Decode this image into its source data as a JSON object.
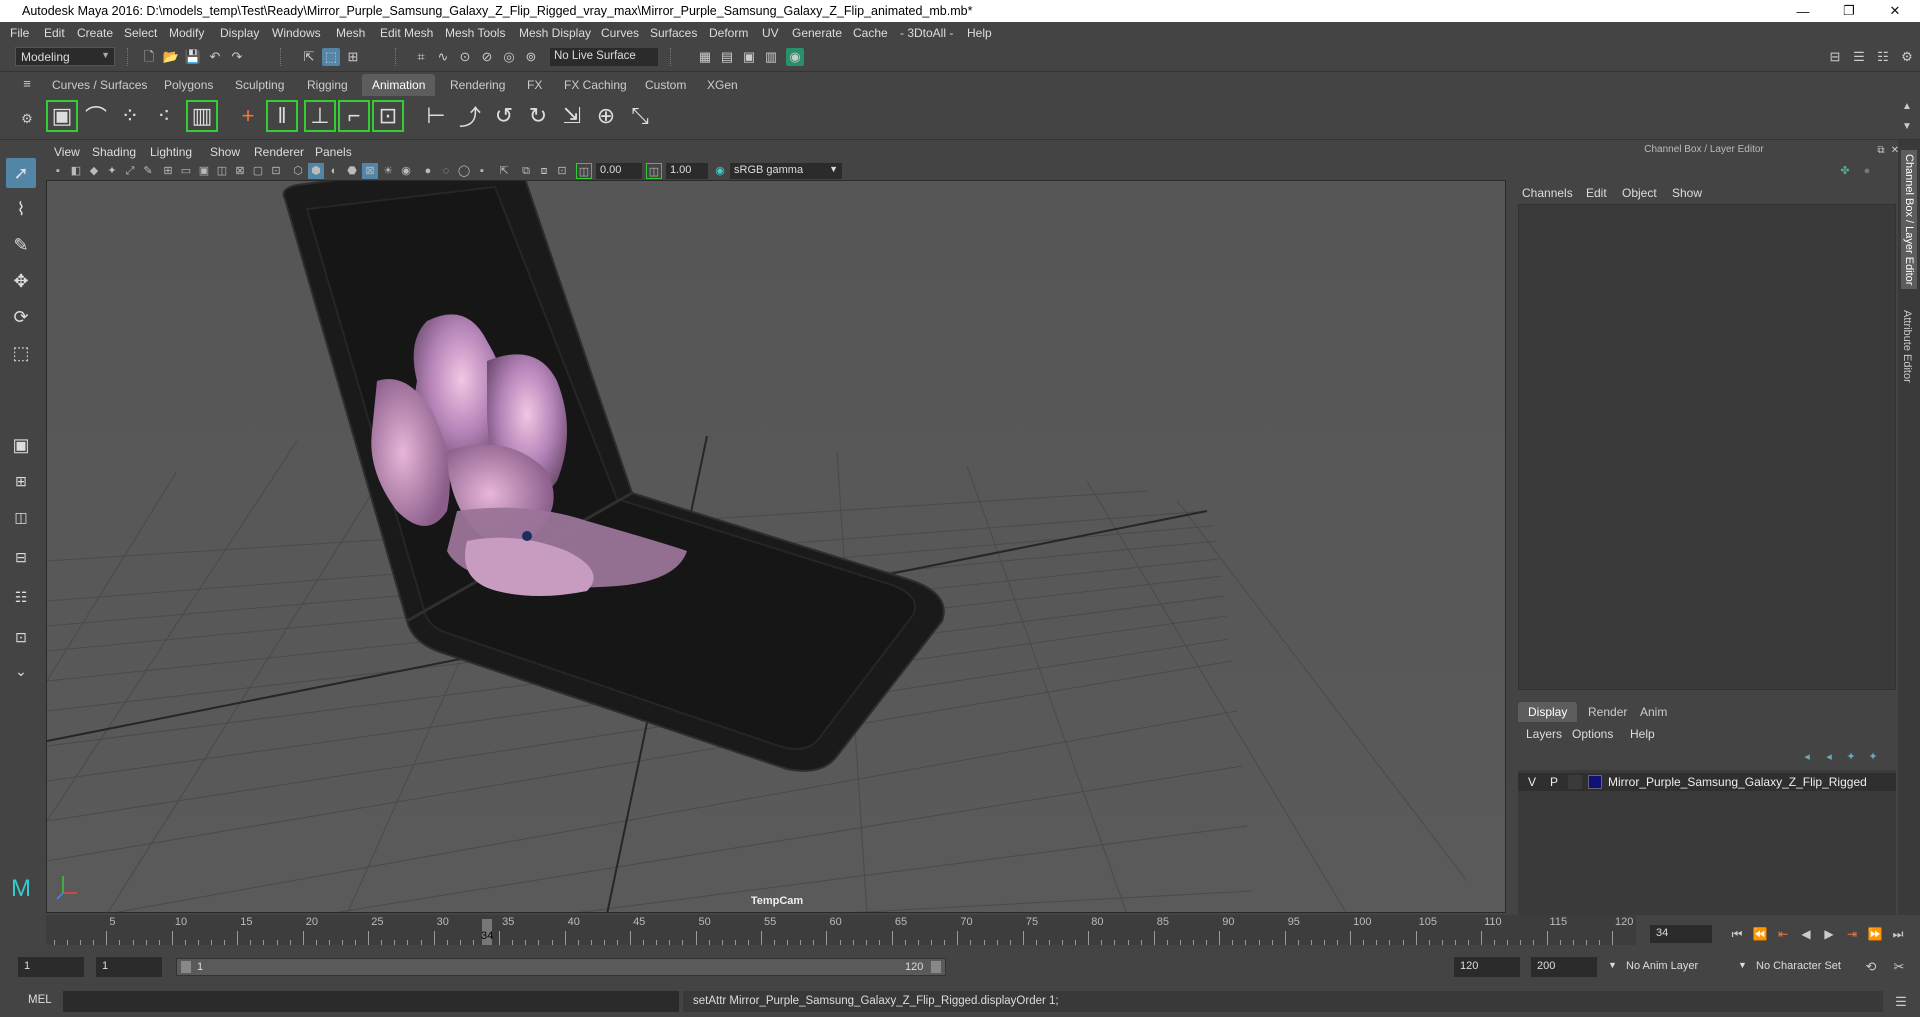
{
  "window": {
    "title": "Autodesk Maya 2016: D:\\models_temp\\Test\\Ready\\Mirror_Purple_Samsung_Galaxy_Z_Flip_Rigged_vray_max\\Mirror_Purple_Samsung_Galaxy_Z_Flip_animated_mb.mb*",
    "minimize": "—",
    "restore": "❐",
    "close": "✕"
  },
  "menubar": [
    "File",
    "Edit",
    "Create",
    "Select",
    "Modify",
    "Display",
    "Windows",
    "Mesh",
    "Edit Mesh",
    "Mesh Tools",
    "Mesh Display",
    "Curves",
    "Surfaces",
    "Deform",
    "UV",
    "Generate",
    "Cache",
    "- 3DtoAll -",
    "Help"
  ],
  "statusline": {
    "mode": "Modeling",
    "live_surface": "No Live Surface"
  },
  "shelf_tabs": [
    "Curves / Surfaces",
    "Polygons",
    "Sculpting",
    "Rigging",
    "Animation",
    "Rendering",
    "FX",
    "FX Caching",
    "Custom",
    "XGen"
  ],
  "shelf_active": "Animation",
  "viewport": {
    "menu": [
      "View",
      "Shading",
      "Lighting",
      "Show",
      "Renderer",
      "Panels"
    ],
    "exposure": "0.00",
    "gamma": "1.00",
    "colorspace": "sRGB gamma",
    "camera": "TempCam"
  },
  "channel_box": {
    "title": "Channel Box / Layer Editor",
    "menu": [
      "Channels",
      "Edit",
      "Object",
      "Show"
    ]
  },
  "layer_editor": {
    "tabs": [
      "Display",
      "Render",
      "Anim"
    ],
    "menu": [
      "Layers",
      "Options",
      "Help"
    ],
    "layer": {
      "v": "V",
      "p": "P",
      "name": "Mirror_Purple_Samsung_Galaxy_Z_Flip_Rigged",
      "color": "#10107a"
    }
  },
  "side_tabs": [
    "Channel Box / Layer Editor",
    "Attribute Editor"
  ],
  "timeline": {
    "ticks": [
      "5",
      "10",
      "15",
      "20",
      "25",
      "30",
      "35",
      "40",
      "45",
      "50",
      "55",
      "60",
      "65",
      "70",
      "75",
      "80",
      "85",
      "90",
      "95",
      "100",
      "105",
      "110",
      "115",
      "120"
    ],
    "current_frame_marker": "34",
    "current_frame": "34"
  },
  "range": {
    "start": "1",
    "playback_start": "1",
    "slider_start": "1",
    "slider_end": "120",
    "playback_end": "120",
    "end": "200",
    "anim_layer": "No Anim Layer",
    "character_set": "No Character Set"
  },
  "command": {
    "label": "MEL",
    "result": "setAttr Mirror_Purple_Samsung_Galaxy_Z_Flip_Rigged.displayOrder 1;"
  }
}
